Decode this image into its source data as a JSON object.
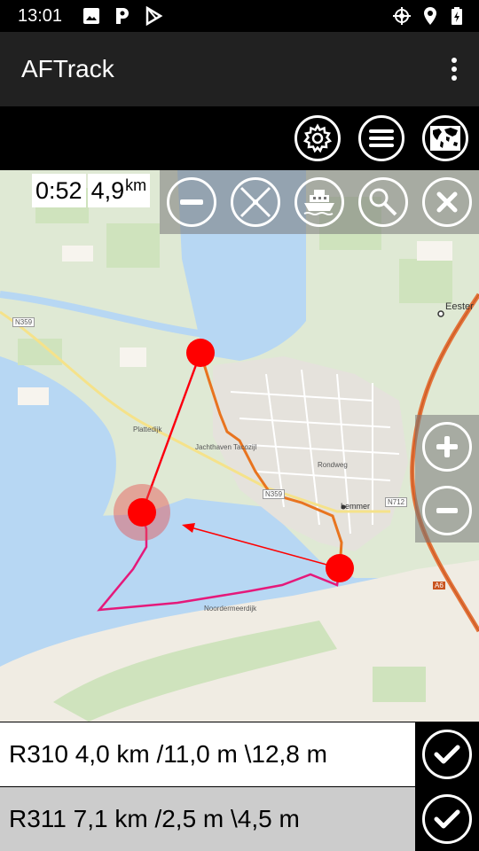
{
  "status_bar": {
    "time": "13:01",
    "left_icons": [
      "image-icon",
      "parking-icon",
      "play-store-icon"
    ],
    "right_icons": [
      "gps-target-icon",
      "location-pin-icon",
      "battery-charging-icon"
    ]
  },
  "app": {
    "title": "AFTrack"
  },
  "toolbar": {
    "icons": [
      "settings-icon",
      "menu-icon",
      "world-map-icon"
    ]
  },
  "stats": {
    "time": "0:52",
    "distance": "4,9",
    "distance_unit": "km"
  },
  "map_controls": [
    "zoom-out-minus-icon",
    "cross-icon",
    "boat-icon",
    "search-icon",
    "close-icon"
  ],
  "zoom_controls": [
    "zoom-in-icon",
    "zoom-out-icon"
  ],
  "map_labels": {
    "town_lemmer": "Lemmer",
    "town_eesterga": "Eester",
    "road_n359": "N359",
    "road_n712": "N712",
    "road_a6": "A6",
    "harbour": "Jachthaven Tacozijl",
    "street_rondweg": "Rondweg",
    "street_plattedijk": "Plattedijk",
    "dike": "Noordermeerdijk"
  },
  "routes": [
    {
      "label": "R310 4,0 km /11,0 m \\12,8 m",
      "selected": true
    },
    {
      "label": "R311 7,1 km /2,5 m \\4,5 m",
      "selected": false
    }
  ],
  "colors": {
    "track_pink": "#e5197a",
    "route_orange": "#e8741f",
    "waypoint_red": "#ff0000",
    "water": "#b7d7f3",
    "land": "#dfe9d4"
  }
}
